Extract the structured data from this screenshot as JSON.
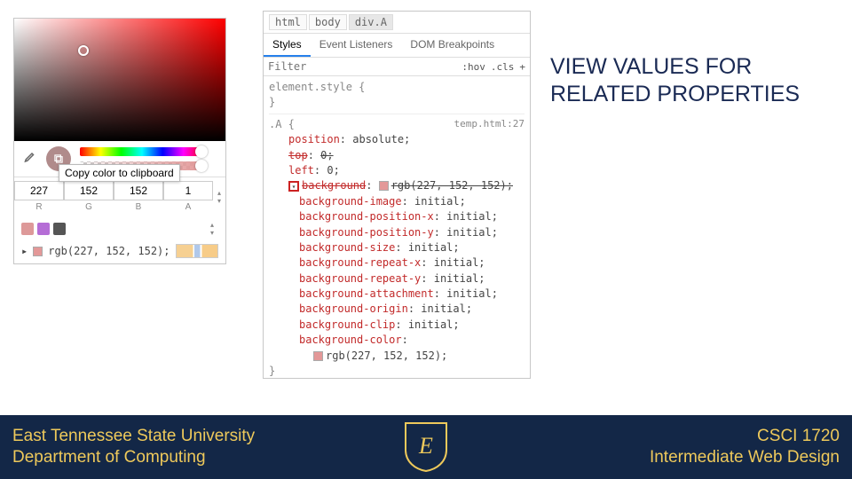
{
  "title": "VIEW VALUES FOR RELATED PROPERTIES",
  "color_picker": {
    "tooltip": "Copy color to clipboard",
    "channels": {
      "r": "227",
      "g": "152",
      "b": "152",
      "a": "1",
      "r_lab": "R",
      "g_lab": "G",
      "b_lab": "B",
      "a_lab": "A"
    },
    "rgb_out": "rgb(227, 152, 152);"
  },
  "devtools": {
    "crumb": [
      "html",
      "body",
      "div.A"
    ],
    "tabs": {
      "styles": "Styles",
      "listeners": "Event Listeners",
      "dom": "DOM Breakpoints"
    },
    "filter_placeholder": "Filter",
    "hov": ":hov",
    "cls": ".cls",
    "plus": "+",
    "rule1_sel": "element.style {",
    "rule1_close": "}",
    "rule2_sel": ".A {",
    "rule2_src": "temp.html:27",
    "rule2_close": "}",
    "decl": [
      {
        "p": "position",
        "v": "absolute;",
        "strike": false
      },
      {
        "p": "top",
        "v": "0;",
        "strike": true
      },
      {
        "p": "left",
        "v": "0;",
        "strike": false
      },
      {
        "p": "background",
        "v": "rgb(227, 152, 152);",
        "strike": true,
        "swatch": true,
        "expand": true
      },
      {
        "p": "background-image",
        "v": "initial;",
        "strike": false
      },
      {
        "p": "background-position-x",
        "v": "initial;",
        "strike": false
      },
      {
        "p": "background-position-y",
        "v": "initial;",
        "strike": false
      },
      {
        "p": "background-size",
        "v": "initial;",
        "strike": false
      },
      {
        "p": "background-repeat-x",
        "v": "initial;",
        "strike": false
      },
      {
        "p": "background-repeat-y",
        "v": "initial;",
        "strike": false
      },
      {
        "p": "background-attachment",
        "v": "initial;",
        "strike": false
      },
      {
        "p": "background-origin",
        "v": "initial;",
        "strike": false
      },
      {
        "p": "background-clip",
        "v": "initial;",
        "strike": false
      },
      {
        "p": "background-color",
        "v": "rgb(227, 152, 152);",
        "strike": false,
        "swatch": true,
        "newline": true
      }
    ]
  },
  "footer": {
    "uni": "East Tennessee State University",
    "dept": "Department of Computing",
    "course": "CSCI 1720",
    "cname": "Intermediate Web Design"
  }
}
